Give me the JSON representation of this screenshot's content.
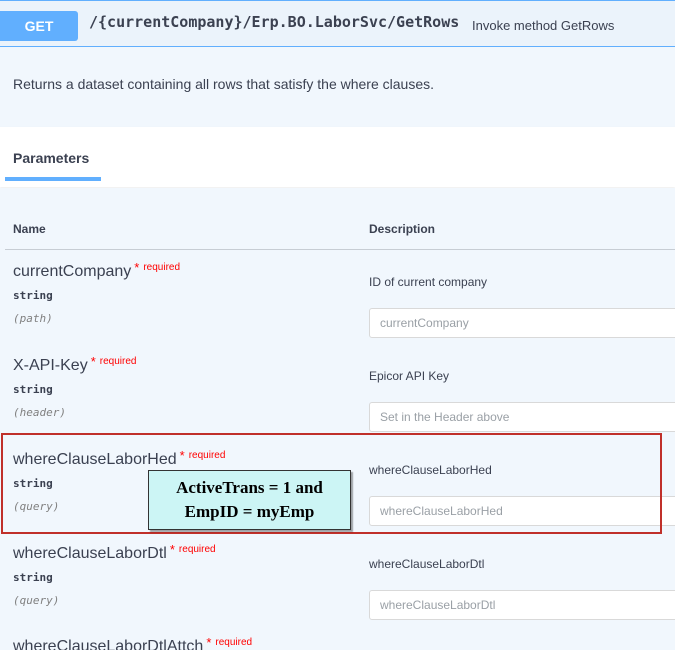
{
  "endpoint": {
    "method": "GET",
    "path": "/{currentCompany}/Erp.BO.LaborSvc/GetRows",
    "summary": "Invoke method GetRows",
    "description": "Returns a dataset containing all rows that satisfy the where clauses."
  },
  "parameters_section": {
    "title": "Parameters",
    "col_name": "Name",
    "col_description": "Description"
  },
  "required_label": "required",
  "required_star": "*",
  "parameters": [
    {
      "name": "currentCompany",
      "type": "string",
      "in": "(path)",
      "description": "ID of current company",
      "placeholder": "currentCompany"
    },
    {
      "name": "X-API-Key",
      "type": "string",
      "in": "(header)",
      "description": "Epicor API Key",
      "placeholder": "Set in the Header above"
    },
    {
      "name": "whereClauseLaborHed",
      "type": "string",
      "in": "(query)",
      "description": "whereClauseLaborHed",
      "placeholder": "whereClauseLaborHed"
    },
    {
      "name": "whereClauseLaborDtl",
      "type": "string",
      "in": "(query)",
      "description": "whereClauseLaborDtl",
      "placeholder": "whereClauseLaborDtl"
    },
    {
      "name": "whereClauseLaborDtlAttch"
    }
  ],
  "annotation": {
    "line1": "ActiveTrans = 1 and",
    "line2": "EmpID = myEmp",
    "highlight_color": "#c0302a",
    "callout_bg": "#ccf5f5"
  },
  "colors": {
    "accent": "#61affe",
    "background_tint": "#ebf3fb",
    "text": "#3b4151",
    "required": "#ff0000"
  }
}
